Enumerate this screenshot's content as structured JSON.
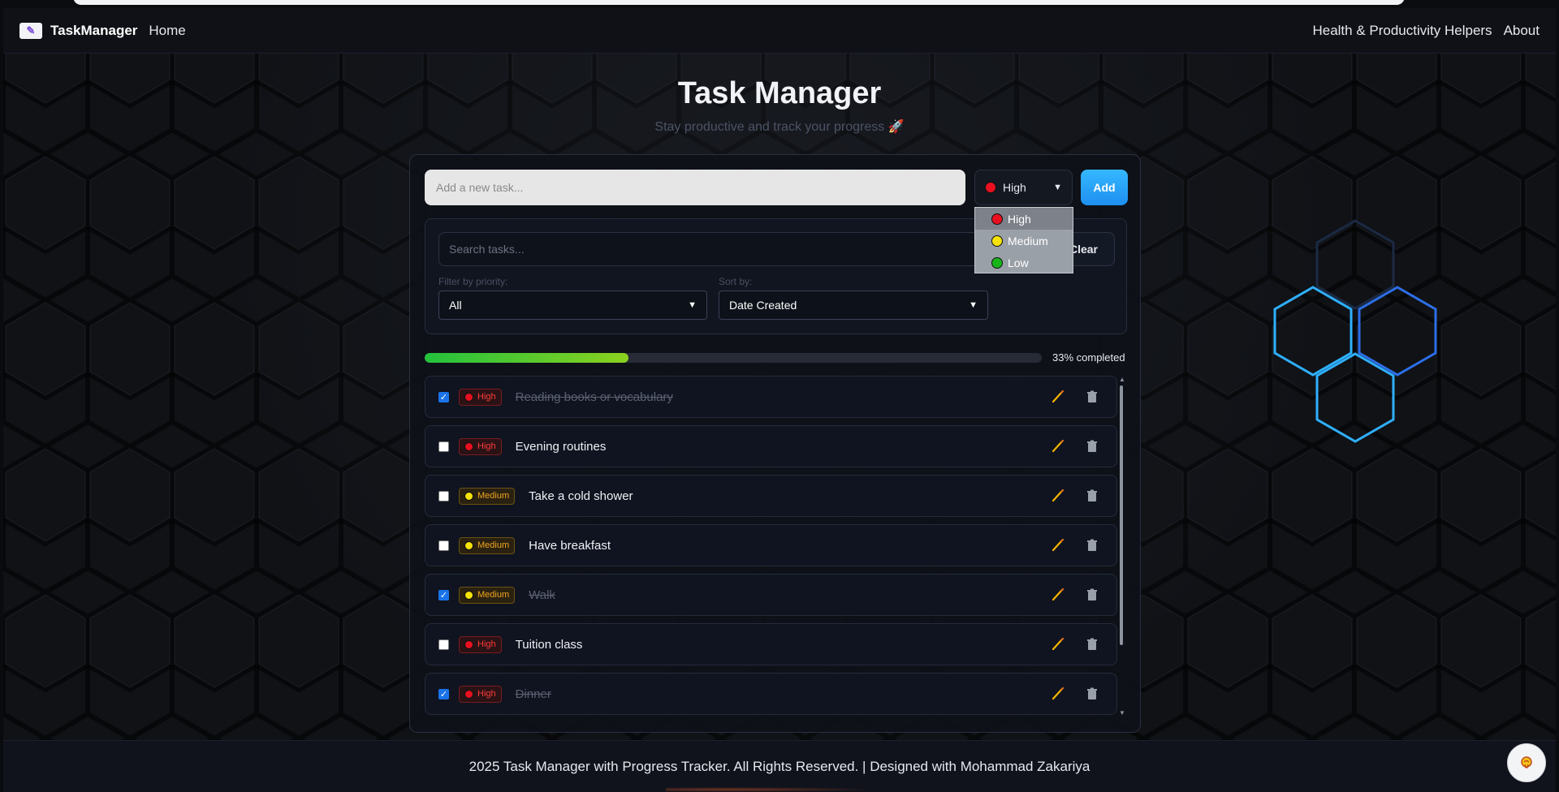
{
  "navbar": {
    "brand": "TaskManager",
    "home": "Home",
    "links": [
      "Health & Productivity Helpers",
      "About"
    ]
  },
  "header": {
    "title": "Task Manager",
    "subtitle": "Stay productive and track your progress 🚀"
  },
  "new_task": {
    "placeholder": "Add a new task...",
    "priority_selected": "High",
    "add_label": "Add"
  },
  "priority_dropdown": {
    "options": [
      {
        "label": "High",
        "color": "#e8101f"
      },
      {
        "label": "Medium",
        "color": "#f5e30a"
      },
      {
        "label": "Low",
        "color": "#17b51a"
      }
    ]
  },
  "filters": {
    "search_placeholder": "Search tasks...",
    "clear_label": "Clear",
    "priority_label": "Filter by priority:",
    "priority_value": "All",
    "sort_label": "Sort by:",
    "sort_value": "Date Created"
  },
  "progress": {
    "percent": 33,
    "text": "33% completed"
  },
  "tasks": [
    {
      "text": "Reading books or vocabulary",
      "priority": "High",
      "done": true
    },
    {
      "text": "Evening routines",
      "priority": "High",
      "done": false
    },
    {
      "text": "Take a cold shower",
      "priority": "Medium",
      "done": false
    },
    {
      "text": "Have breakfast",
      "priority": "Medium",
      "done": false
    },
    {
      "text": "Walk",
      "priority": "Medium",
      "done": true
    },
    {
      "text": "Tuition class",
      "priority": "High",
      "done": false
    },
    {
      "text": "Dinner",
      "priority": "High",
      "done": true
    }
  ],
  "footer": {
    "text": "2025 Task Manager with Progress Tracker. All Rights Reserved. | Designed with Mohammad Zakariya"
  },
  "colors": {
    "accent": "#1e8ff0",
    "high": "#ff3b3b",
    "medium": "#f0a520",
    "progress_start": "#23c23d",
    "progress_end": "#8bd11e"
  },
  "icons": {
    "brand_logo": "notepad-pen-icon",
    "edit": "pencil-icon",
    "delete": "trash-icon",
    "help": "brain-icon"
  }
}
